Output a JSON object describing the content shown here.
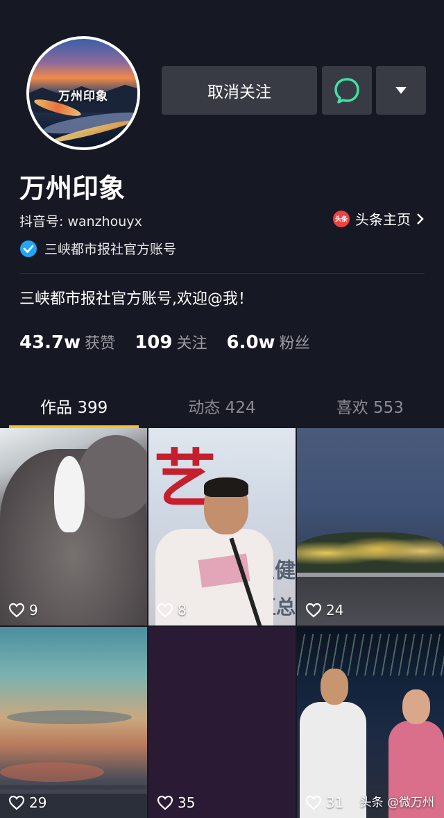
{
  "profile": {
    "avatar_text": "万州印象",
    "name": "万州印象",
    "douyin_id": "抖音号: wanzhouyx",
    "toutiao_badge": "头条",
    "toutiao_link": "头条主页",
    "verified_text": "三峡都市报社官方账号",
    "bio": "三峡都市报社官方账号,欢迎@我！"
  },
  "actions": {
    "unfollow_label": "取消关注"
  },
  "stats": [
    {
      "value": "43.7w",
      "label": "获赞"
    },
    {
      "value": "109",
      "label": "关注"
    },
    {
      "value": "6.0w",
      "label": "粉丝"
    }
  ],
  "tabs": [
    {
      "label": "作品 399",
      "active": true
    },
    {
      "label": "动态 424",
      "active": false
    },
    {
      "label": "喜欢 553",
      "active": false
    }
  ],
  "videos": [
    {
      "likes": "9"
    },
    {
      "likes": "8"
    },
    {
      "likes": "24"
    },
    {
      "likes": "29"
    },
    {
      "likes": "35"
    },
    {
      "likes": "31"
    }
  ],
  "video_text": {
    "t2_char": "艺",
    "t2_line1": "主健",
    "t2_line2": "区总"
  },
  "watermark": "头条 @微万州",
  "colors": {
    "background": "#161823",
    "tab_indicator": "#f9c227",
    "button_bg": "#393b44",
    "message_icon": "#3fe1a6"
  }
}
